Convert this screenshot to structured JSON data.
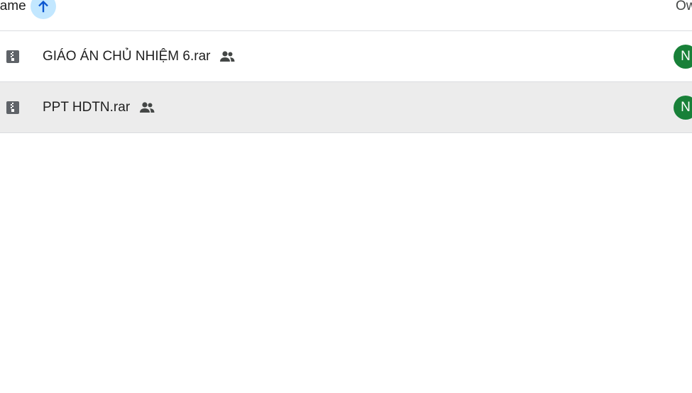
{
  "header": {
    "name_label": "Name",
    "sort_direction_icon": "arrow-up-icon",
    "owner_label": "Owner"
  },
  "files": [
    {
      "type_icon": "archive-file-icon",
      "name": "GIÁO ÁN CHỦ NHIỆM 6.rar",
      "shared_icon": "people-shared-icon",
      "owner_initial": "N",
      "selected": false
    },
    {
      "type_icon": "archive-file-icon",
      "name": "PPT HDTN.rar",
      "shared_icon": "people-shared-icon",
      "owner_initial": "N",
      "selected": true
    }
  ],
  "colors": {
    "sort_button_bg": "#c2e7ff",
    "sort_arrow": "#0b57d0",
    "avatar_bg": "#188038",
    "selected_row_bg": "#ececec",
    "divider": "#dadce0"
  }
}
